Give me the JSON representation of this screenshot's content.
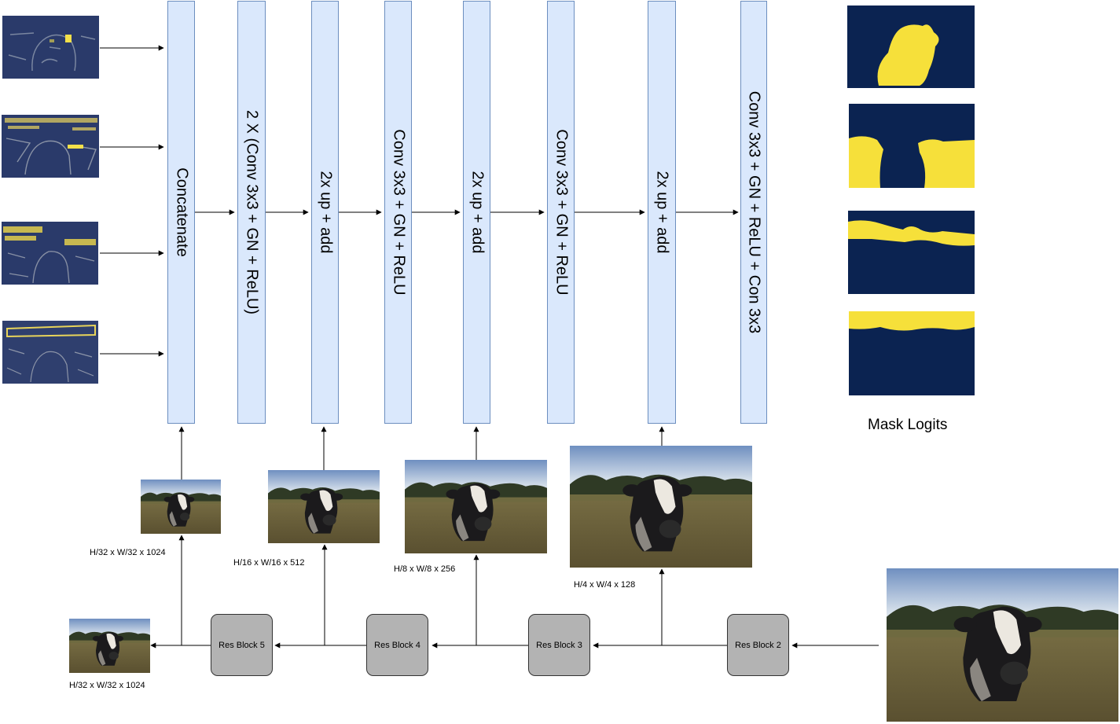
{
  "blocks": {
    "concatenate": "Concatenate",
    "conv_x2": "2 X (Conv 3x3 + GN + ReLU)",
    "up_add_1": "2x up + add",
    "conv_1": "Conv 3x3 + GN + ReLU",
    "up_add_2": "2x up + add",
    "conv_2": "Conv 3x3 + GN + ReLU",
    "up_add_3": "2x up + add",
    "final_conv": "Conv 3x3 + GN + ReLU + Con 3x3"
  },
  "res_blocks": {
    "rb5": "Res Block 5",
    "rb4": "Res Block 4",
    "rb3": "Res Block 3",
    "rb2": "Res Block 2"
  },
  "captions": {
    "c32_top": "H/32 x W/32 x 1024",
    "c16": "H/16 x W/16 x 512",
    "c8": "H/8 x W/8 x 256",
    "c4": "H/4 x W/4 x 128",
    "c32_bottom": "H/32 x W/32 x 1024"
  },
  "mask_logits_label": "Mask Logits",
  "colors": {
    "block_fill": "#dae8fc",
    "block_stroke": "#6c8ebf",
    "resblock_fill": "#b3b3b3",
    "mask_background": "#0b2351",
    "mask_foreground": "#f6e03a"
  }
}
